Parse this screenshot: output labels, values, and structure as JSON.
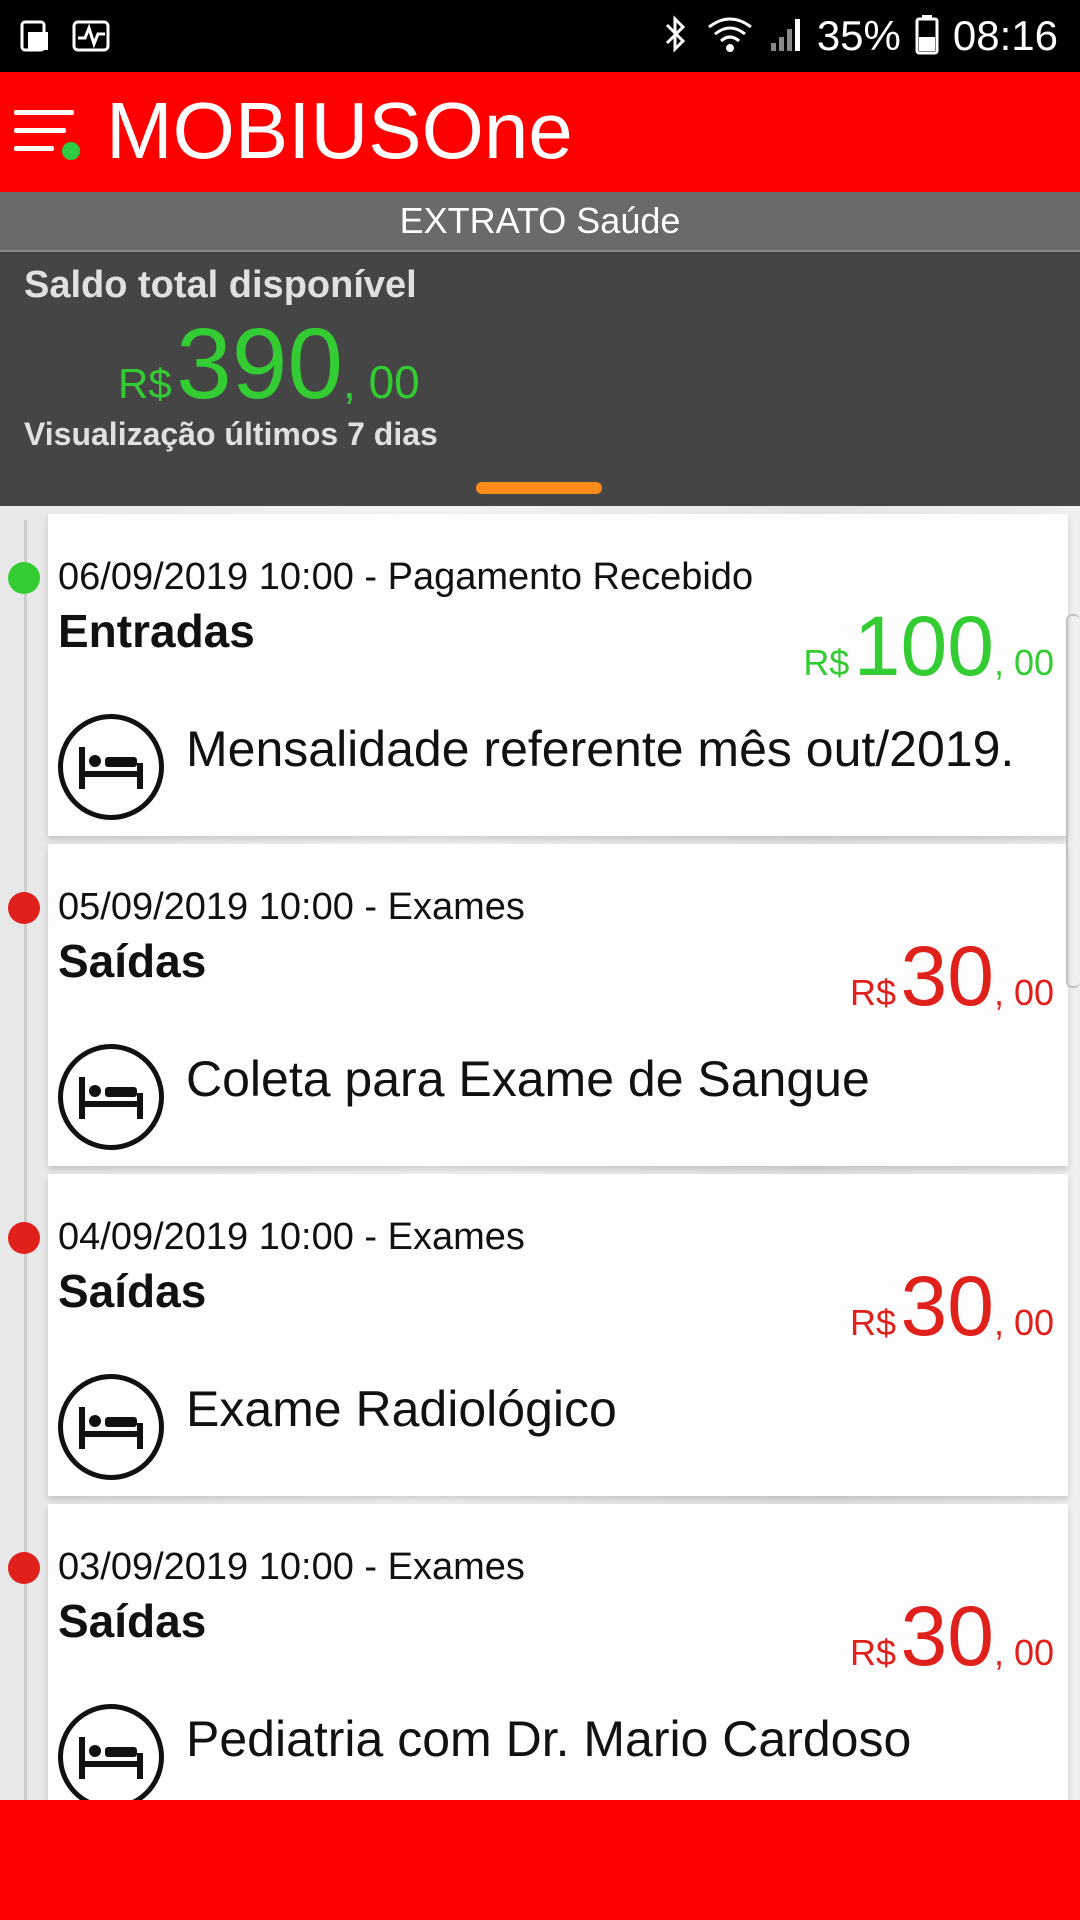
{
  "status_bar": {
    "battery_percent": "35%",
    "time": "08:16",
    "icons": [
      "sim-icon",
      "activity-icon",
      "bluetooth-icon",
      "wifi-icon",
      "signal-icon",
      "battery-icon"
    ]
  },
  "app_bar": {
    "title": "MOBIUSOne",
    "menu_icon": "menu-icon",
    "online_indicator_color": "#2ecc40"
  },
  "header": {
    "title": "EXTRATO Saúde"
  },
  "balance": {
    "label": "Saldo total disponível",
    "currency": "R$",
    "integer": "390",
    "decimal": ", 00",
    "subtitle": "Visualização últimos 7 dias"
  },
  "colors": {
    "brand_red": "#ff0000",
    "income_green": "#33cc33",
    "expense_red": "#e0201b",
    "tab_orange": "#ff8c1a"
  },
  "entries": [
    {
      "header": "06/09/2019 10:00 - Pagamento Recebido",
      "kind": "Entradas",
      "currency": "R$",
      "integer": "100",
      "decimal": ", 00",
      "description": "Mensalidade referente mês out/2019.",
      "icon": "bed-icon",
      "type": "income"
    },
    {
      "header": "05/09/2019 10:00 - Exames",
      "kind": "Saídas",
      "currency": "R$",
      "integer": "30",
      "decimal": ", 00",
      "description": "Coleta para Exame de Sangue",
      "icon": "bed-icon",
      "type": "expense"
    },
    {
      "header": "04/09/2019 10:00 - Exames",
      "kind": "Saídas",
      "currency": "R$",
      "integer": "30",
      "decimal": ", 00",
      "description": "Exame Radiológico",
      "icon": "bed-icon",
      "type": "expense"
    },
    {
      "header": "03/09/2019 10:00 - Exames",
      "kind": "Saídas",
      "currency": "R$",
      "integer": "30",
      "decimal": ", 00",
      "description": "Pediatria com Dr. Mario Cardoso",
      "icon": "bed-icon",
      "type": "expense"
    }
  ]
}
